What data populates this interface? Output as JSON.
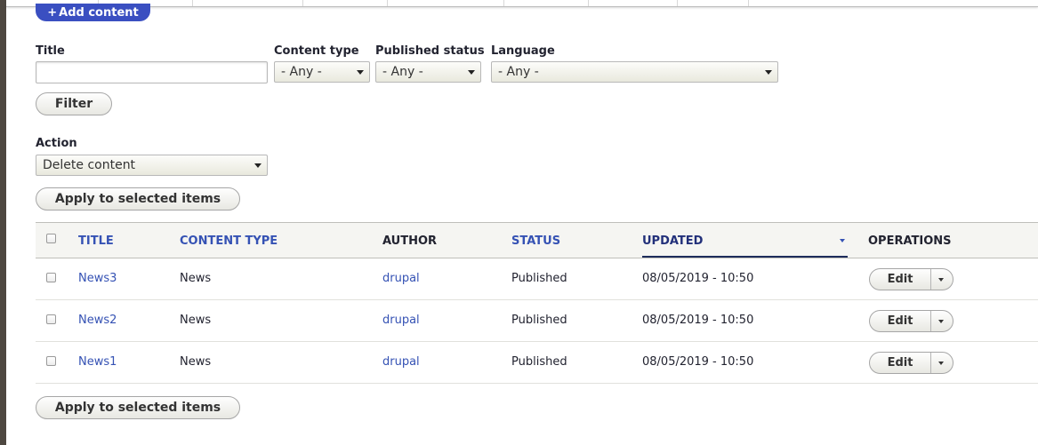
{
  "toolbar": {
    "add_content_label": "Add content",
    "add_icon": "plus-icon"
  },
  "filters": {
    "title_label": "Title",
    "title_value": "",
    "content_type_label": "Content type",
    "content_type_value": "- Any -",
    "published_status_label": "Published status",
    "published_status_value": "- Any -",
    "language_label": "Language",
    "language_value": "- Any -",
    "filter_button": "Filter"
  },
  "bulk": {
    "action_label": "Action",
    "action_value": "Delete content",
    "apply_button": "Apply to selected items"
  },
  "table": {
    "columns": {
      "title": "TITLE",
      "content_type": "CONTENT TYPE",
      "author": "AUTHOR",
      "status": "STATUS",
      "updated": "UPDATED",
      "operations": "OPERATIONS"
    },
    "rows": [
      {
        "title": "News3",
        "content_type": "News",
        "author": "drupal",
        "status": "Published",
        "updated": "08/05/2019 - 10:50",
        "operation": "Edit"
      },
      {
        "title": "News2",
        "content_type": "News",
        "author": "drupal",
        "status": "Published",
        "updated": "08/05/2019 - 10:50",
        "operation": "Edit"
      },
      {
        "title": "News1",
        "content_type": "News",
        "author": "drupal",
        "status": "Published",
        "updated": "08/05/2019 - 10:50",
        "operation": "Edit"
      }
    ]
  },
  "colors": {
    "accent": "#3a4fc1",
    "link": "#3552b4",
    "active_underline": "#1e2d5c"
  }
}
